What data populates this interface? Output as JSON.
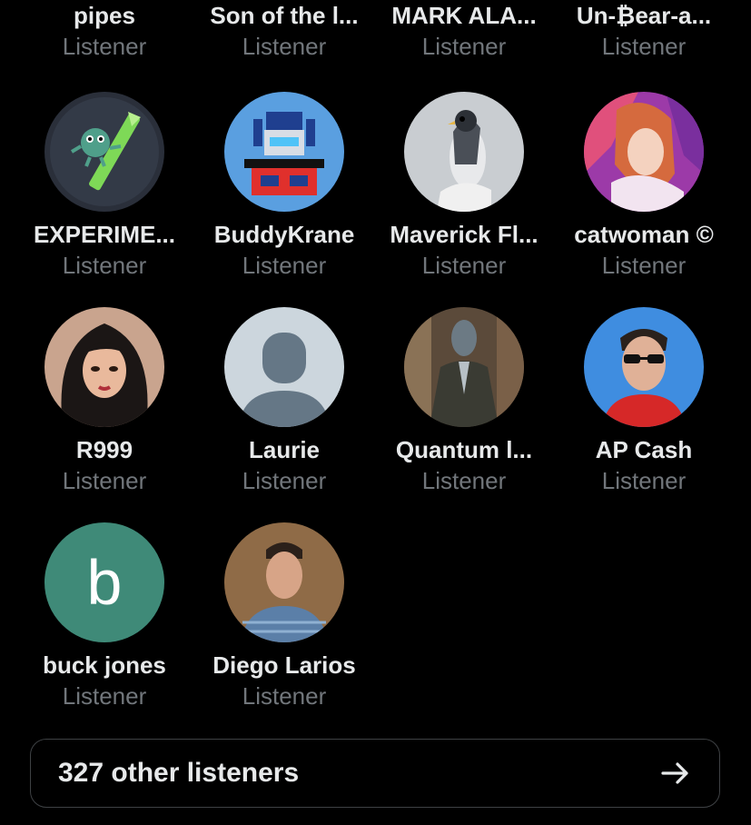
{
  "listeners": [
    {
      "name": "pipes",
      "role": "Listener"
    },
    {
      "name": "Son of the l...",
      "role": "Listener"
    },
    {
      "name": "MARK ALA...",
      "role": "Listener"
    },
    {
      "name": "Un-₿ear-a...",
      "role": "Listener"
    },
    {
      "name": "EXPERIME...",
      "role": "Listener"
    },
    {
      "name": "BuddyKrane",
      "role": "Listener"
    },
    {
      "name": "Maverick Fl...",
      "role": "Listener"
    },
    {
      "name": "catwoman ©",
      "role": "Listener"
    },
    {
      "name": "R999",
      "role": "Listener"
    },
    {
      "name": "Laurie",
      "role": "Listener"
    },
    {
      "name": "Quantum l...",
      "role": "Listener"
    },
    {
      "name": "AP Cash",
      "role": "Listener"
    },
    {
      "name": "buck jones",
      "role": "Listener",
      "avatar_letter": "b"
    },
    {
      "name": "Diego Larios",
      "role": "Listener"
    }
  ],
  "other_listeners": {
    "label": "327 other listeners",
    "icon": "arrow-right-icon"
  },
  "colors": {
    "background": "#000000",
    "name_text": "#e7e9ea",
    "role_text": "#71767b",
    "letter_avatar": "#3f8a78",
    "default_avatar": "#ccd6dd"
  }
}
